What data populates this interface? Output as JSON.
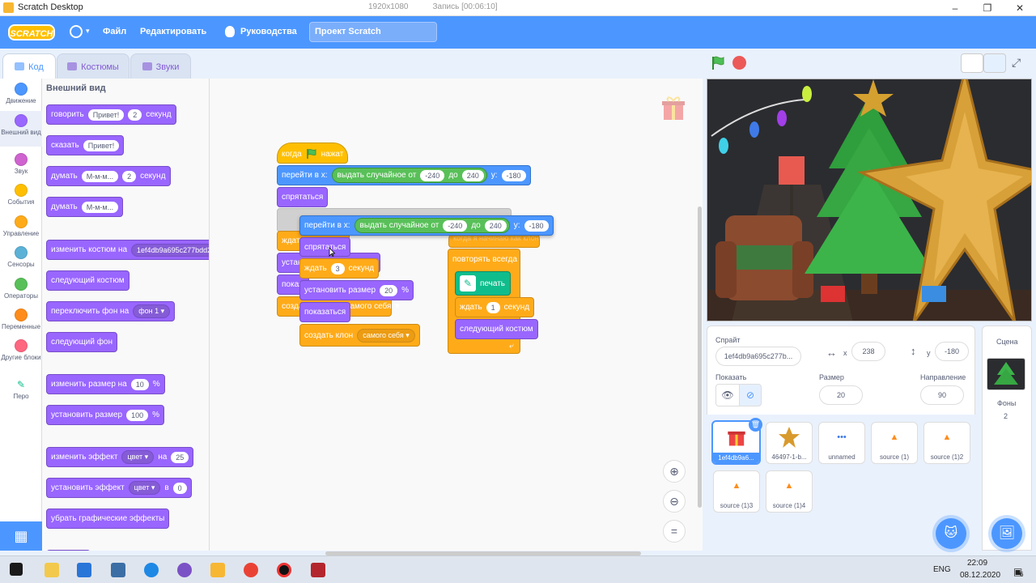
{
  "window": {
    "title": "Scratch Desktop",
    "resolution": "1920x1080",
    "recording": "Запись [00:06:10]"
  },
  "menubar": {
    "logo": "SCRATCH",
    "file": "Файл",
    "edit": "Редактировать",
    "tutorials": "Руководства",
    "project_title": "Проект Scratch"
  },
  "tabs": {
    "code": "Код",
    "costumes": "Костюмы",
    "sounds": "Звуки"
  },
  "categories": [
    {
      "label": "Движение",
      "color": "#4c97ff"
    },
    {
      "label": "Внешний вид",
      "color": "#9966ff"
    },
    {
      "label": "Звук",
      "color": "#cf63cf"
    },
    {
      "label": "События",
      "color": "#ffbf00"
    },
    {
      "label": "Управление",
      "color": "#ffab19"
    },
    {
      "label": "Сенсоры",
      "color": "#5cb1d6"
    },
    {
      "label": "Операторы",
      "color": "#59c059"
    },
    {
      "label": "Переменные",
      "color": "#ff8c1a"
    },
    {
      "label": "Другие блоки",
      "color": "#ff6680"
    },
    {
      "label": "Перо",
      "color": "#0fbd8c"
    }
  ],
  "palette": {
    "heading": "Внешний вид",
    "say_for": {
      "a": "говорить",
      "msg": "Привет!",
      "secs": "2",
      "b": "секунд"
    },
    "say": {
      "a": "сказать",
      "msg": "Привет!"
    },
    "think_for": {
      "a": "думать",
      "msg": "М-м-м...",
      "secs": "2",
      "b": "секунд"
    },
    "think": {
      "a": "думать",
      "msg": "М-м-м..."
    },
    "switch_costume": {
      "a": "изменить костюм на",
      "value": "1ef4db9a695c277bdd2c0"
    },
    "next_costume": "следующий костюм",
    "switch_backdrop": {
      "a": "переключить фон на",
      "value": "фон 1"
    },
    "next_backdrop": "следующий фон",
    "change_size": {
      "a": "изменить размер на",
      "value": "10",
      "b": "%"
    },
    "set_size": {
      "a": "установить размер",
      "value": "100",
      "b": "%"
    },
    "change_effect": {
      "a": "изменить эффект",
      "effect": "цвет",
      "b": "на",
      "value": "25"
    },
    "set_effect": {
      "a": "установить эффект",
      "effect": "цвет",
      "b": "в",
      "value": "0"
    },
    "clear_effects": "убрать графические эффекты"
  },
  "script": {
    "when_flag": {
      "a": "когда",
      "b": "нажат"
    },
    "goto1": {
      "a": "перейти в x:",
      "op": "выдать случайное от",
      "from": "-240",
      "to_label": "до",
      "to": "240",
      "y_label": "y:",
      "y": "-180"
    },
    "hide": "спрятаться",
    "goto2": {
      "a": "перейти в x:",
      "op": "выдать случайное от",
      "from": "-240",
      "to_label": "до",
      "to": "240",
      "y_label": "y:",
      "y": "-180"
    },
    "hide2": "спрятаться",
    "wait": {
      "a": "ждать",
      "value": "3",
      "b": "секунд"
    },
    "set_size": {
      "a": "установить размер",
      "value": "20",
      "b": "%"
    },
    "show": "показаться",
    "clone": {
      "a": "создать клон",
      "value": "самого себя"
    },
    "behind_wait": "ждат",
    "behind_set": "устан",
    "behind_show": "показ",
    "behind_clone": "созда",
    "behind_clone_value": "самого себя",
    "clone_hat": "когда я начинаю как клон",
    "forever": "повторять всегда",
    "stamp": "печать",
    "wait2": {
      "a": "ждать",
      "value": "1",
      "b": "секунд"
    },
    "next_costume": "следующий костюм"
  },
  "sprite_info": {
    "sprite_label": "Спрайт",
    "sprite_name": "1ef4db9a695c277b...",
    "x_label": "x",
    "x": "238",
    "y_label": "y",
    "y": "-180",
    "show_label": "Показать",
    "size_label": "Размер",
    "size": "20",
    "direction_label": "Направление",
    "direction": "90"
  },
  "sprites": [
    "1ef4db9a6...",
    "46497-1-b...",
    "unnamed",
    "source (1)",
    "source (1)2",
    "source (1)3",
    "source (1)4"
  ],
  "stage_panel": {
    "label": "Сцена",
    "backdrops_label": "Фоны",
    "backdrops_count": "2"
  },
  "taskbar": {
    "lang": "ENG",
    "time": "22:09",
    "date": "08.12.2020",
    "notifications": "6"
  }
}
